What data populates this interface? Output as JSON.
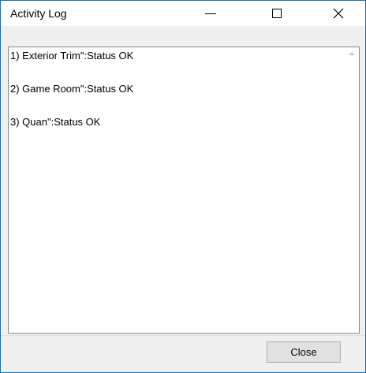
{
  "window": {
    "title": "Activity Log"
  },
  "titlebar": {
    "buttons": [
      {
        "icon": "minimize-icon"
      },
      {
        "icon": "maximize-icon"
      },
      {
        "icon": "close-icon",
        "glyph": "✕"
      }
    ]
  },
  "log": {
    "entries": [
      {
        "text": "1)  Exterior Trim\":Status OK"
      },
      {
        "text": "2)  Game Room\":Status OK"
      },
      {
        "text": "3)  Quan\":Status OK"
      }
    ]
  },
  "footer": {
    "close_label": "Close"
  }
}
